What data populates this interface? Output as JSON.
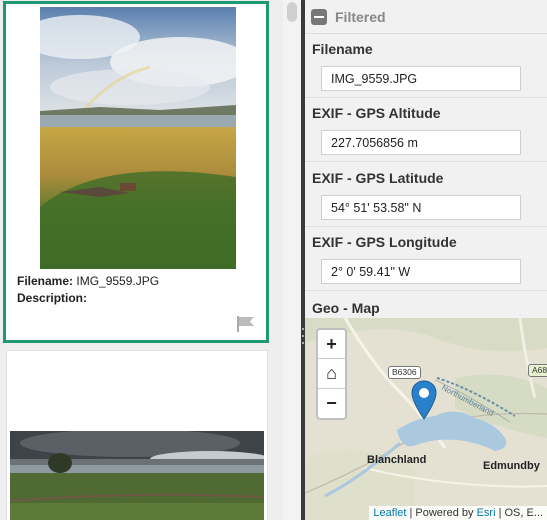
{
  "gallery": {
    "cards": [
      {
        "filename_label": "Filename:",
        "filename": "IMG_9559.JPG",
        "description_label": "Description:",
        "description": ""
      }
    ]
  },
  "details": {
    "section_title": "Filtered",
    "fields": [
      {
        "label": "Filename",
        "value": "IMG_9559.JPG"
      },
      {
        "label": "EXIF - GPS Altitude",
        "value": "227.7056856 m"
      },
      {
        "label": "EXIF - GPS Latitude",
        "value": "54° 51' 53.58\" N"
      },
      {
        "label": "EXIF - GPS Longitude",
        "value": "2° 0' 59.41\" W"
      }
    ],
    "geo_label": "Geo - Map"
  },
  "map": {
    "zoom_in": "+",
    "home": "⌂",
    "zoom_out": "−",
    "road_b6306": "B6306",
    "road_a68": "A68",
    "place_blanchland": "Blanchland",
    "place_edmundbyers": "Edmundby",
    "water_label": "Northumberland",
    "attribution_leaflet": "Leaflet",
    "attribution_mid": " | Powered by ",
    "attribution_esri": "Esri",
    "attribution_tail": " | OS, E..."
  },
  "colors": {
    "selection_border": "#1e9a72",
    "marker": "#2a81cb",
    "water": "#aac9de",
    "link": "#0078a8"
  }
}
